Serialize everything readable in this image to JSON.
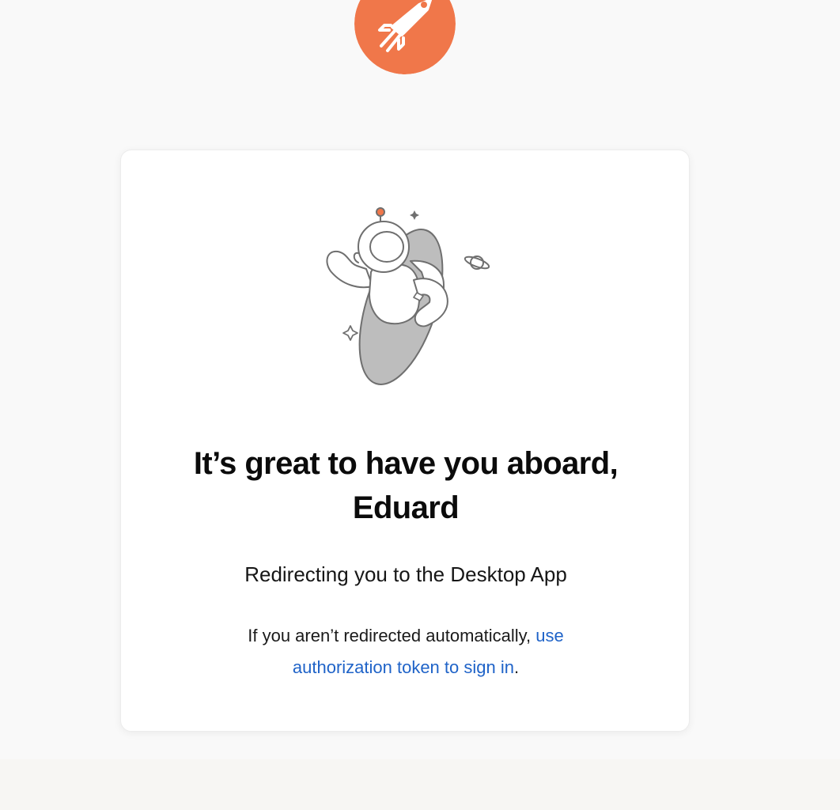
{
  "colors": {
    "page_background": "#f9f9f9",
    "card_background": "#ffffff",
    "brand_orange": "#f0774a",
    "link_blue": "#1f63c8"
  },
  "logo": {
    "icon": "postman-logo-icon"
  },
  "illustration": {
    "icon": "astronaut-riding-rocket-icon"
  },
  "card": {
    "headline": "It’s great to have you aboard, Eduard",
    "subtitle": "Redirecting you to the Desktop App",
    "fallback": {
      "text": "If you aren’t redirected automatically, ",
      "link_label": "use authorization token to sign in",
      "suffix": "."
    }
  }
}
